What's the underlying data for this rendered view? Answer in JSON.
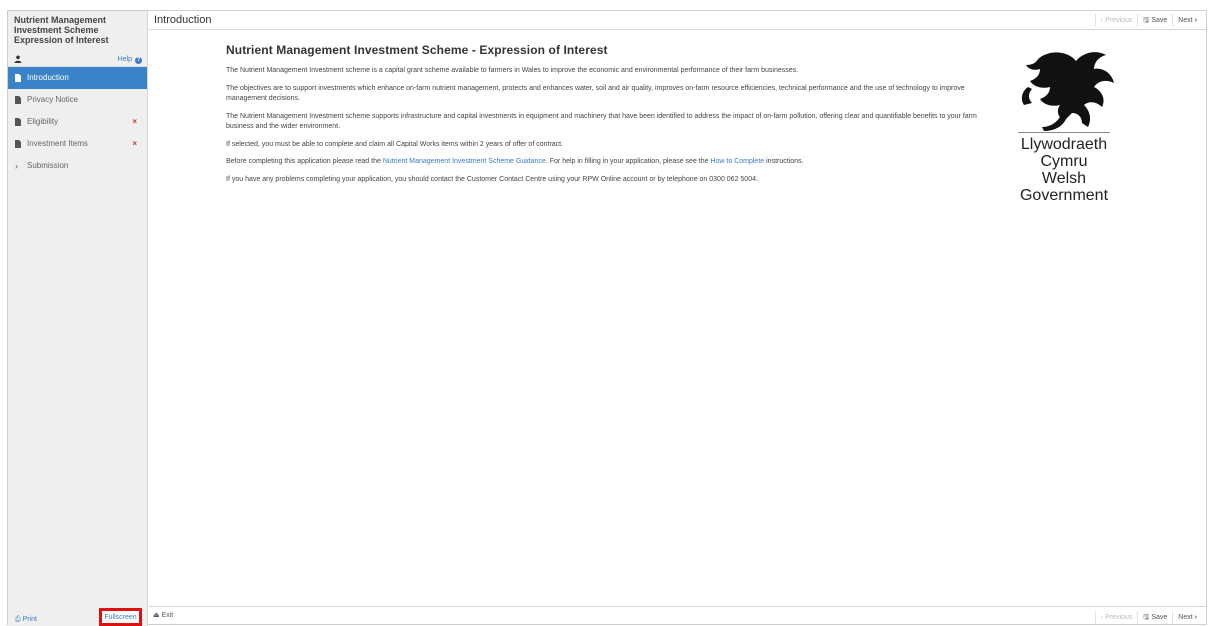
{
  "app": {
    "title_line1": "Nutrient Management",
    "title_line2": "Investment Scheme",
    "title_line3": "Expression of Interest"
  },
  "header": {
    "help_label": "Help"
  },
  "sidebar": {
    "items": [
      {
        "label": "Introduction",
        "active": true,
        "error": false
      },
      {
        "label": "Privacy Notice",
        "active": false,
        "error": false
      },
      {
        "label": "Eligibility",
        "active": false,
        "error": true
      },
      {
        "label": "Investment Items",
        "active": false,
        "error": true
      },
      {
        "label": "Submission",
        "active": false,
        "error": false
      }
    ],
    "error_mark": "×",
    "print_label": "Print",
    "fullscreen_label": "Fullscreen"
  },
  "topbar": {
    "page_title": "Introduction",
    "previous_label": "Previous",
    "save_label": "Save",
    "next_label": "Next"
  },
  "bottombar": {
    "exit_label": "Exit",
    "previous_label": "Previous",
    "save_label": "Save",
    "next_label": "Next"
  },
  "content": {
    "heading": "Nutrient Management Investment Scheme - Expression of Interest",
    "p1": "The Nutrient Management Investment scheme is a capital grant scheme available to farmers in Wales to improve the economic and environmental performance of their farm businesses.",
    "p2": "The objectives are to support investments which enhance on-farm nutrient management, protects and enhances water, soil and air quality, improves on-farm resource efficiencies, technical performance and the use of technology to improve management decisions.",
    "p3": "The Nutrient Management Investment scheme supports infrastructure and capital investments in equipment and machinery that have been identified to address the impact of on-farm pollution, offering clear and quantifiable benefits to your farm business and the wider environment.",
    "p4": "If selected, you must be able to complete and claim all Capital Works items within 2 years of offer of contract.",
    "p5_before": "Before completing this application please read the ",
    "p5_link1": "Nutrient Management Investment Scheme Guidance",
    "p5_middle": ". For help in filling in your application, please see the ",
    "p5_link2": "How to Complete",
    "p5_after": " instructions.",
    "p6": "If you have any problems completing your application, you should contact the Customer Contact Centre using your RPW Online account or by telephone on 0300 062 5004."
  },
  "logo": {
    "line1": "Llywodraeth Cymru",
    "line2": "Welsh Government"
  },
  "colors": {
    "accent": "#3a83c8",
    "link": "#3a7bc4",
    "error": "#c0392b",
    "highlight": "#e01010"
  }
}
